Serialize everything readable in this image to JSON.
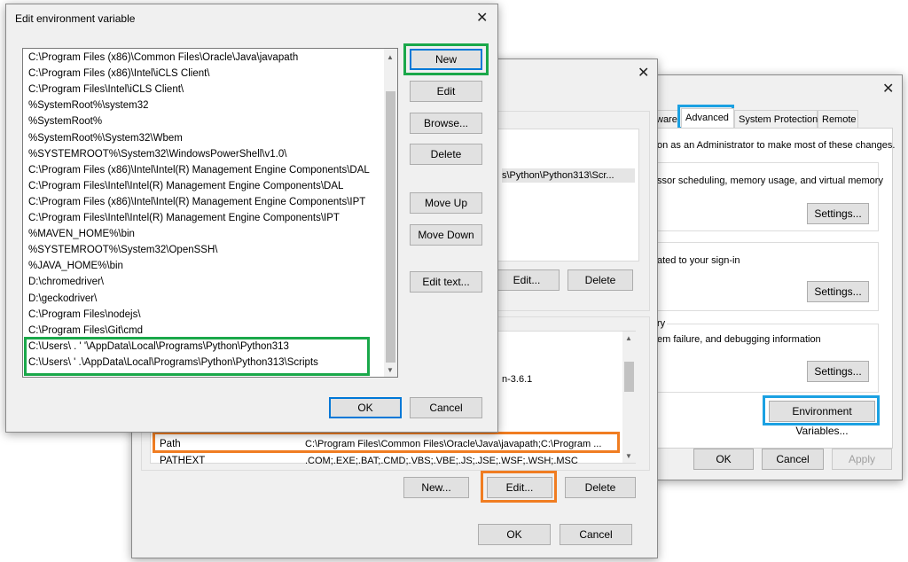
{
  "sysprops": {
    "tabs": [
      "ware",
      "Advanced",
      "System Protection",
      "Remote"
    ],
    "admin_note": "on as an Administrator to make most of these changes.",
    "perf_desc": "ssor scheduling, memory usage, and virtual memory",
    "profiles_desc": "ated to your sign-in",
    "startup_label": "ry",
    "startup_desc": "em failure, and debugging information",
    "settings_label": "Settings...",
    "env_vars_label": "Environment Variables...",
    "ok_label": "OK",
    "cancel_label": "Cancel",
    "apply_label": "Apply"
  },
  "envvars": {
    "user_partial_value": "s\\Python\\Python313\\Scr...",
    "user_edit_label": "Edit...",
    "user_delete_label": "Delete",
    "sys_partial": "n-3.6.1",
    "sys_rows": [
      {
        "name": "Path",
        "value": "C:\\Program Files\\Common Files\\Oracle\\Java\\javapath;C:\\Program ..."
      },
      {
        "name": "PATHEXT",
        "value": ".COM;.EXE;.BAT;.CMD;.VBS;.VBE;.JS;.JSE;.WSF;.WSH;.MSC"
      }
    ],
    "new_label": "New...",
    "edit_label": "Edit...",
    "delete_label": "Delete",
    "ok_label": "OK",
    "cancel_label": "Cancel"
  },
  "editdlg": {
    "title": "Edit environment variable",
    "entries": [
      "C:\\Program Files (x86)\\Common Files\\Oracle\\Java\\javapath",
      "C:\\Program Files (x86)\\Intel\\iCLS Client\\",
      "C:\\Program Files\\Intel\\iCLS Client\\",
      "%SystemRoot%\\system32",
      "%SystemRoot%",
      "%SystemRoot%\\System32\\Wbem",
      "%SYSTEMROOT%\\System32\\WindowsPowerShell\\v1.0\\",
      "C:\\Program Files (x86)\\Intel\\Intel(R) Management Engine Components\\DAL",
      "C:\\Program Files\\Intel\\Intel(R) Management Engine Components\\DAL",
      "C:\\Program Files (x86)\\Intel\\Intel(R) Management Engine Components\\IPT",
      "C:\\Program Files\\Intel\\Intel(R) Management Engine Components\\IPT",
      "%MAVEN_HOME%\\bin",
      "%SYSTEMROOT%\\System32\\OpenSSH\\",
      "%JAVA_HOME%\\bin",
      "D:\\chromedriver\\",
      "D:\\geckodriver\\",
      "C:\\Program Files\\nodejs\\",
      "C:\\Program Files\\Git\\cmd",
      "C:\\Users\\  .  '  '\\AppData\\Local\\Programs\\Python\\Python313",
      "C:\\Users\\    '    .\\AppData\\Local\\Programs\\Python\\Python313\\Scripts"
    ],
    "buttons": {
      "new": "New",
      "edit": "Edit",
      "browse": "Browse...",
      "delete": "Delete",
      "move_up": "Move Up",
      "move_down": "Move Down",
      "edit_text": "Edit text..."
    },
    "ok_label": "OK",
    "cancel_label": "Cancel"
  },
  "colors": {
    "highlight_green": "#1aa84a",
    "highlight_blue": "#1ba1e2",
    "highlight_orange": "#f07d22",
    "accent": "#0078d7"
  },
  "icons": {
    "close": "close-icon",
    "scroll_up": "scroll-up-arrow-icon",
    "scroll_down": "scroll-down-arrow-icon"
  }
}
